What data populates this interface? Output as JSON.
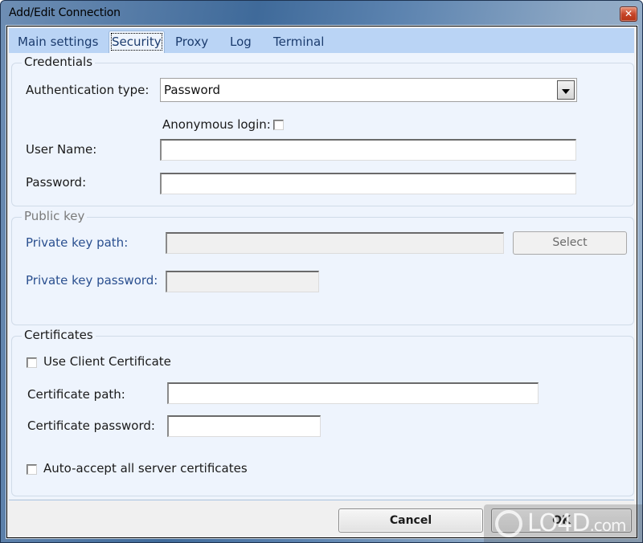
{
  "window": {
    "title": "Add/Edit Connection",
    "close_glyph": "✕"
  },
  "tabs": [
    {
      "label": "Main settings",
      "active": false
    },
    {
      "label": "Security",
      "active": true
    },
    {
      "label": "Proxy",
      "active": false
    },
    {
      "label": "Log",
      "active": false
    },
    {
      "label": "Terminal",
      "active": false
    }
  ],
  "credentials": {
    "group_title": "Credentials",
    "auth_type_label": "Authentication type:",
    "auth_type_value": "Password",
    "anonymous_label": "Anonymous login:",
    "anonymous_checked": false,
    "username_label": "User Name:",
    "username_value": "",
    "password_label": "Password:",
    "password_value": ""
  },
  "public_key": {
    "group_title": "Public key",
    "key_path_label": "Private key path:",
    "key_path_value": "",
    "select_button": "Select",
    "key_password_label": "Private key password:",
    "key_password_value": ""
  },
  "certificates": {
    "group_title": "Certificates",
    "use_client_label": "Use Client Certificate",
    "use_client_checked": false,
    "cert_path_label": "Certificate path:",
    "cert_path_value": "",
    "cert_password_label": "Certificate password:",
    "cert_password_value": "",
    "auto_accept_label": "Auto-accept all server certificates",
    "auto_accept_checked": false
  },
  "footer": {
    "cancel_label": "Cancel",
    "ok_label": "OK"
  },
  "watermark": {
    "text": "LO4D",
    "suffix": ".com"
  }
}
